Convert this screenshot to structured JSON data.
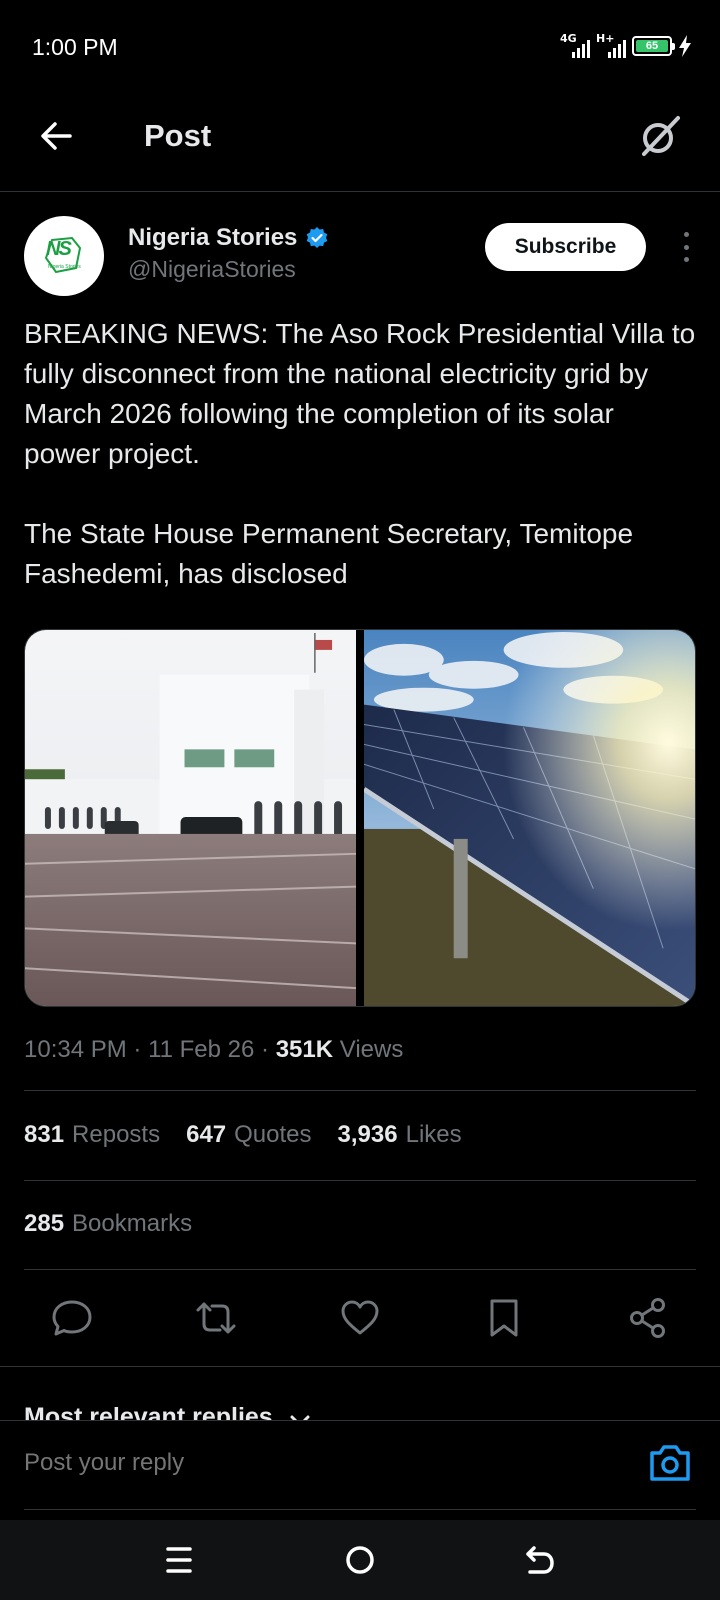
{
  "status_bar": {
    "time": "1:00 PM",
    "network_1": "4G",
    "network_2": "H+",
    "battery": "65"
  },
  "header": {
    "title": "Post",
    "back_icon": "arrow-left-icon",
    "grok_icon": "grok-icon"
  },
  "author": {
    "name": "Nigeria Stories",
    "handle": "@NigeriaStories",
    "verified": true,
    "avatar_text": "NS",
    "avatar_tagline": "Nigeria Stories",
    "subscribe_label": "Subscribe"
  },
  "post": {
    "text": "BREAKING NEWS: The Aso Rock Presidential Villa to fully disconnect from the national electricity grid by March 2026 following the completion of its solar power project.\n\nThe State House Permanent Secretary, Temitope Fashedemi, has disclosed",
    "images": [
      "aso-rock-villa-photo",
      "solar-panels-photo"
    ]
  },
  "meta": {
    "time": "10:34 PM",
    "date": "11 Feb 26",
    "views_count": "351K",
    "views_label": "Views"
  },
  "stats": {
    "reposts_count": "831",
    "reposts_label": "Reposts",
    "quotes_count": "647",
    "quotes_label": "Quotes",
    "likes_count": "3,936",
    "likes_label": "Likes",
    "bookmarks_count": "285",
    "bookmarks_label": "Bookmarks"
  },
  "actions": [
    "reply-icon",
    "repost-icon",
    "like-icon",
    "bookmark-icon",
    "share-icon"
  ],
  "replies": {
    "sort_label": "Most relevant replies"
  },
  "reply_bar": {
    "placeholder": "Post your reply"
  },
  "colors": {
    "background": "#000000",
    "text": "#e7e9ea",
    "muted": "#71767b",
    "accent": "#1d9bf0",
    "divider": "#2f3336"
  }
}
